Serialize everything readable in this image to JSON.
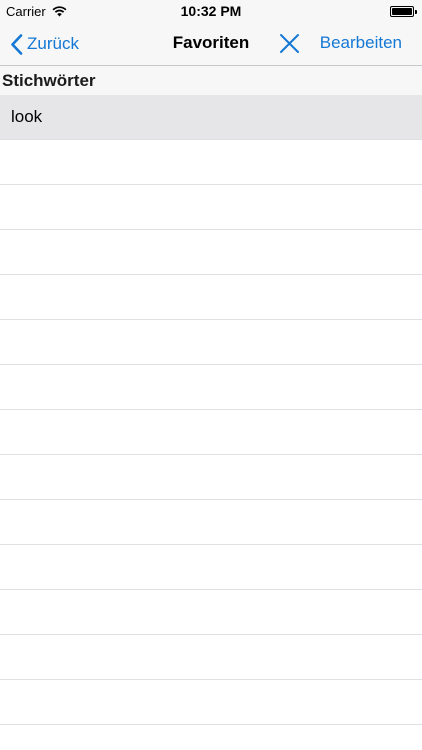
{
  "status_bar": {
    "carrier": "Carrier",
    "time": "10:32 PM",
    "battery_level": 1.0
  },
  "nav": {
    "back_label": "Zurück",
    "title": "Favoriten",
    "edit_label": "Bearbeiten",
    "close_icon": "close-icon",
    "accent_color": "#1478d4"
  },
  "section": {
    "header": "Stichwörter"
  },
  "rows": [
    {
      "label": "look"
    },
    {
      "label": ""
    },
    {
      "label": ""
    },
    {
      "label": ""
    },
    {
      "label": ""
    },
    {
      "label": ""
    },
    {
      "label": ""
    },
    {
      "label": ""
    },
    {
      "label": ""
    },
    {
      "label": ""
    },
    {
      "label": ""
    },
    {
      "label": ""
    },
    {
      "label": ""
    },
    {
      "label": ""
    }
  ]
}
